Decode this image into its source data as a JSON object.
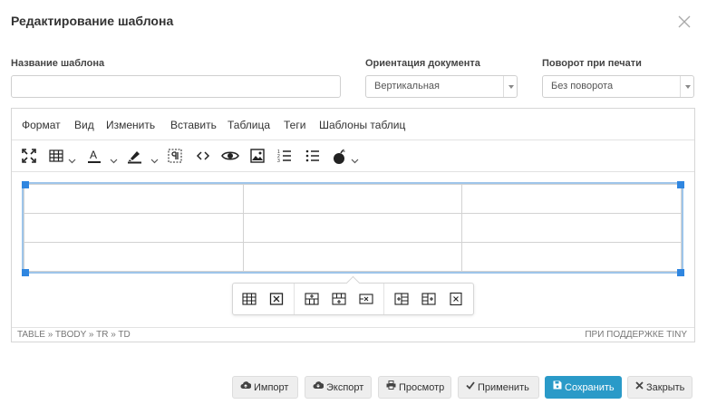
{
  "dialog": {
    "title": "Редактирование шаблона"
  },
  "form": {
    "name_label": "Название шаблона",
    "name_value": "",
    "orientation_label": "Ориентация документа",
    "orientation_value": "Вертикальная",
    "rotation_label": "Поворот при печати",
    "rotation_value": "Без поворота"
  },
  "editor": {
    "menu": [
      "Формат",
      "Вид",
      "Изменить",
      "Вставить",
      "Таблица",
      "Теги",
      "Шаблоны таблиц"
    ],
    "toolbar_icons": [
      "fullscreen-icon",
      "table-icon",
      "text-color-icon",
      "highlight-icon",
      "show-blocks-icon",
      "source-code-icon",
      "preview-icon",
      "image-icon",
      "numbered-list-icon",
      "bullet-list-icon",
      "bomb-icon"
    ],
    "table": {
      "rows": 3,
      "cols": 3,
      "cells": [
        [
          "",
          "",
          ""
        ],
        [
          "",
          "",
          ""
        ],
        [
          "",
          "",
          ""
        ]
      ]
    },
    "context_toolbar_icons": [
      "table-properties-icon",
      "delete-table-icon",
      "row-insert-before-icon",
      "row-insert-after-icon",
      "delete-row-icon",
      "col-insert-before-icon",
      "col-insert-after-icon",
      "delete-col-icon"
    ],
    "status_path": "TABLE » TBODY » TR » TD",
    "status_brand": "ПРИ ПОДДЕРЖКЕ TINY"
  },
  "footer": {
    "import": "Импорт",
    "export": "Экспорт",
    "preview": "Просмотр",
    "apply": "Применить",
    "save": "Сохранить",
    "close": "Закрыть"
  },
  "colors": {
    "primary": "#2a9ac8",
    "selection_handle": "#2f86e0",
    "table_outline": "#9ec5ea"
  }
}
